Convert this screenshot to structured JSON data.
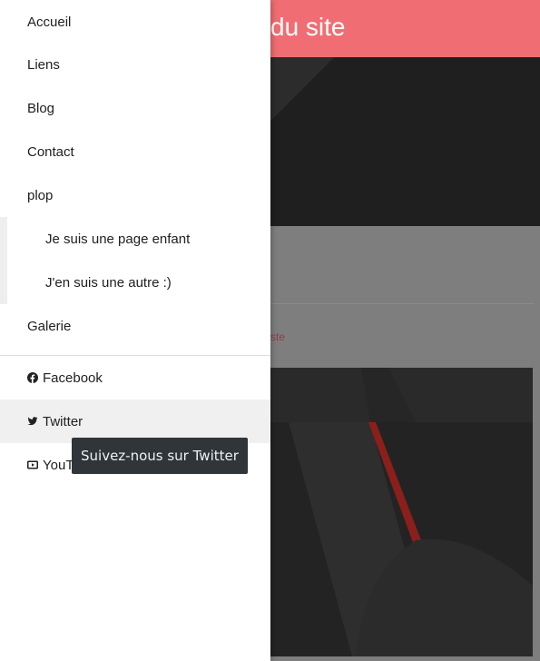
{
  "site": {
    "title_fragment": "du site",
    "link_fragment": "ste"
  },
  "drawer": {
    "nav_items": [
      {
        "label": "Accueil"
      },
      {
        "label": "Liens"
      },
      {
        "label": "Blog"
      },
      {
        "label": "Contact"
      },
      {
        "label": "plop"
      }
    ],
    "children": [
      {
        "label": "Je suis une page enfant"
      },
      {
        "label": "J'en suis une autre :)"
      }
    ],
    "gallery": {
      "label": "Galerie"
    },
    "social": [
      {
        "label": "Facebook",
        "icon": "facebook-icon"
      },
      {
        "label": "Twitter",
        "icon": "twitter-icon"
      },
      {
        "label": "YouT",
        "icon": "youtube-icon"
      }
    ]
  },
  "tooltip": {
    "text": "Suivez-nous sur Twitter"
  },
  "colors": {
    "header_accent": "#f06e73",
    "overlay_gray": "#7e7e7e",
    "hover_bg": "#f0f0f0",
    "tooltip_bg": "#2f3538",
    "hero_dark": "#1f1f1f"
  }
}
